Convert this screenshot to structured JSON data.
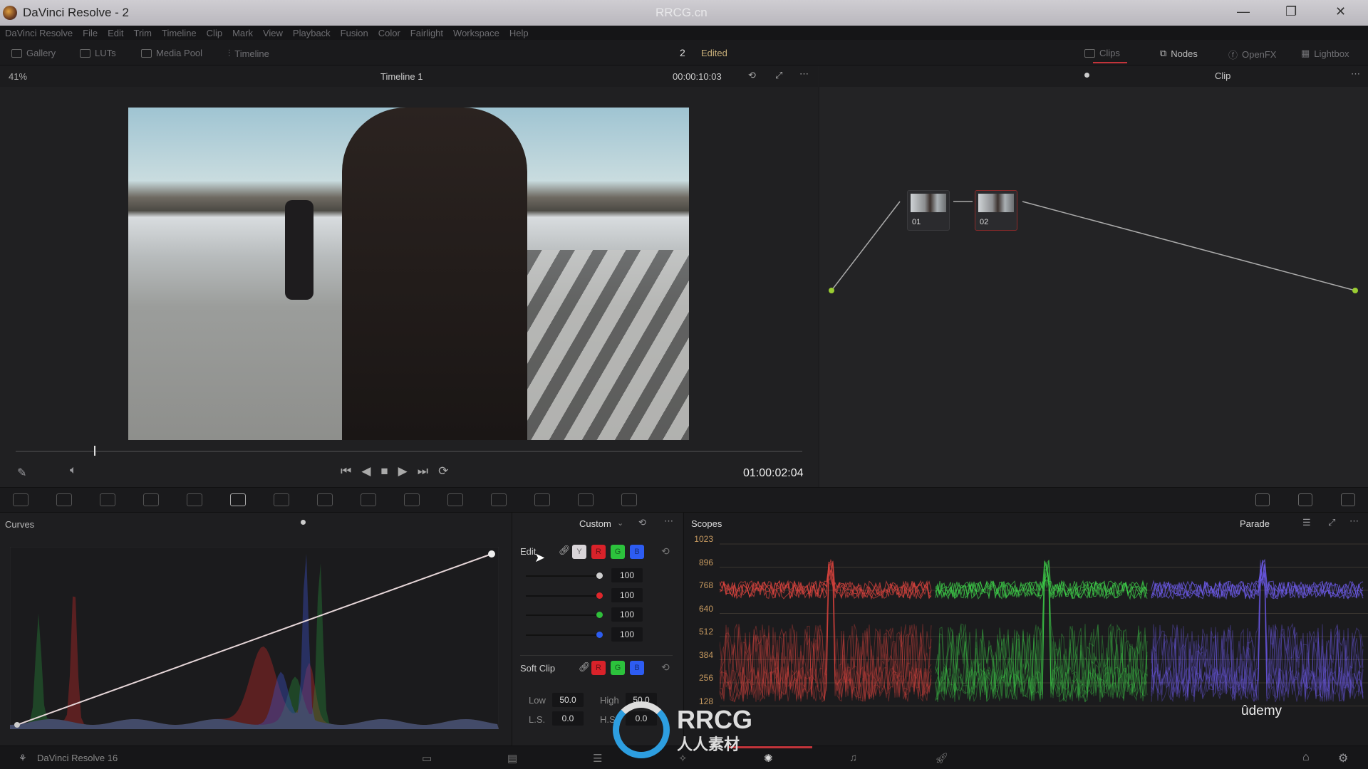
{
  "window": {
    "title": "DaVinci Resolve - 2",
    "minimize": "—",
    "maximize": "❐",
    "close": "✕",
    "watermark": "RRCG.cn"
  },
  "menu": [
    "DaVinci Resolve",
    "File",
    "Edit",
    "Trim",
    "Timeline",
    "Clip",
    "Mark",
    "View",
    "Playback",
    "Fusion",
    "Color",
    "Fairlight",
    "Workspace",
    "Help"
  ],
  "toolbar": {
    "left": [
      "Gallery",
      "LUTs",
      "Media Pool",
      "Timeline"
    ],
    "project_number": "2",
    "project_status": "Edited",
    "right": [
      "Clips",
      "Nodes",
      "OpenFX",
      "Lightbox"
    ]
  },
  "viewer": {
    "zoom": "41%",
    "timeline": "Timeline 1",
    "source_timecode": "00:00:10:03",
    "timecode": "01:00:02:04",
    "playhead_fraction": 0.1
  },
  "nodes": {
    "mode": "Clip",
    "items": [
      {
        "label": "01"
      },
      {
        "label": "02"
      }
    ]
  },
  "curves": {
    "title": "Curves",
    "mode": "Custom"
  },
  "edit": {
    "label": "Edit",
    "channels": [
      "Y",
      "R",
      "G",
      "B"
    ],
    "values": [
      "100",
      "100",
      "100",
      "100"
    ],
    "knob_colors": [
      "#cfcfcf",
      "#e0262b",
      "#2fbf3a",
      "#2c5cf0"
    ]
  },
  "soft_clip": {
    "label": "Soft Clip",
    "channels": [
      "R",
      "G",
      "B"
    ],
    "low_label": "Low",
    "low": "50.0",
    "high_label": "High",
    "high": "50.0",
    "ls_label": "L.S.",
    "ls": "0.0",
    "hs_label": "H.S.",
    "hs": "0.0"
  },
  "scopes": {
    "title": "Scopes",
    "mode": "Parade",
    "ticks": [
      "1023",
      "896",
      "768",
      "640",
      "512",
      "384",
      "256",
      "128"
    ]
  },
  "footer": {
    "app": "DaVinci Resolve 16",
    "watermark_brand": "RRCG",
    "watermark_sub": "人人素材",
    "udemy": "ûdemy"
  },
  "colors": {
    "accent_red": "#c2343a",
    "y": "#d8d4d8",
    "r": "#d9222a",
    "g": "#2cc23c",
    "b": "#2d5cf2"
  }
}
